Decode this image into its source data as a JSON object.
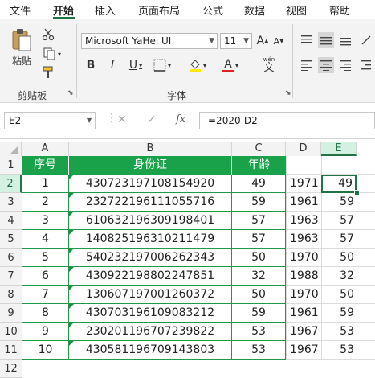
{
  "ribbon_tabs": [
    "文件",
    "开始",
    "插入",
    "页面布局",
    "公式",
    "数据",
    "视图",
    "帮助"
  ],
  "active_tab": "开始",
  "clipboard": {
    "paste_label": "粘贴",
    "group_label": "剪贴板"
  },
  "font": {
    "name": "Microsoft YaHei UI",
    "size": "11",
    "group_label": "字体",
    "wen_label": "wén",
    "wen_char": "文",
    "bold": "B",
    "italic": "I",
    "underline": "U",
    "grow": "A",
    "shrink": "A",
    "font_color": "A"
  },
  "colors": {
    "accent": "#217346",
    "header_fill": "#19a24a",
    "font_red": "#e0201b",
    "highlight_yellow": "#ffeb00"
  },
  "formula_bar": {
    "name_box": "E2",
    "cancel": "✕",
    "enter": "✓",
    "fx": "fx",
    "formula": "=2020-D2"
  },
  "sheet": {
    "columns": [
      "A",
      "B",
      "C",
      "D",
      "E"
    ],
    "rows": [
      "1",
      "2",
      "3",
      "4",
      "5",
      "6",
      "7",
      "8",
      "9",
      "10",
      "11",
      "12"
    ],
    "headers": {
      "a": "序号",
      "b": "身份证",
      "c": "年龄"
    },
    "data": [
      {
        "a": "1",
        "b": "430723197108154920",
        "c": "49",
        "d": "1971",
        "e": "49"
      },
      {
        "a": "2",
        "b": "232722196111055716",
        "c": "59",
        "d": "1961",
        "e": "59"
      },
      {
        "a": "3",
        "b": "610632196309198401",
        "c": "57",
        "d": "1963",
        "e": "57"
      },
      {
        "a": "4",
        "b": "140825196310211479",
        "c": "57",
        "d": "1963",
        "e": "57"
      },
      {
        "a": "5",
        "b": "540232197006262343",
        "c": "50",
        "d": "1970",
        "e": "50"
      },
      {
        "a": "6",
        "b": "430922198802247851",
        "c": "32",
        "d": "1988",
        "e": "32"
      },
      {
        "a": "7",
        "b": "130607197001260372",
        "c": "50",
        "d": "1970",
        "e": "50"
      },
      {
        "a": "8",
        "b": "430703196109083212",
        "c": "59",
        "d": "1961",
        "e": "59"
      },
      {
        "a": "9",
        "b": "230201196707239822",
        "c": "53",
        "d": "1967",
        "e": "53"
      },
      {
        "a": "10",
        "b": "430581196709143803",
        "c": "53",
        "d": "1967",
        "e": "53"
      }
    ],
    "selected_cell": "E2"
  }
}
